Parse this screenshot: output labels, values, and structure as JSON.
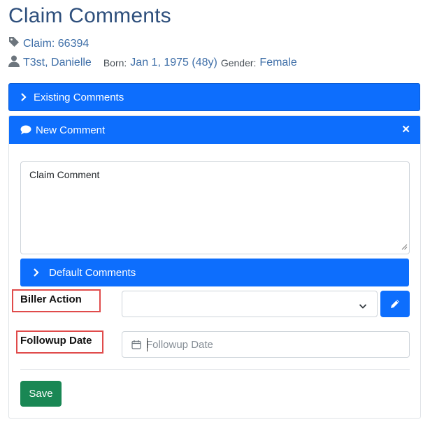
{
  "page": {
    "title": "Claim Comments"
  },
  "claim": {
    "label": "Claim: 66394"
  },
  "patient": {
    "name": "T3st, Danielle",
    "born_label": "Born:",
    "born_value": "Jan 1, 1975 (48y)",
    "gender_label": "Gender:",
    "gender_value": "Female"
  },
  "existing_comments": {
    "label": "Existing Comments",
    "expanded": false
  },
  "new_comment": {
    "label": "New Comment",
    "close_symbol": "✕",
    "comment_text": "Claim Comment",
    "default_comments_label": "Default Comments",
    "biller_action_label": "Biller Action",
    "biller_action_value": "",
    "followup_label": "Followup Date",
    "followup_placeholder": "Followup Date",
    "save_label": "Save"
  },
  "icons": {
    "tag": "tag-icon",
    "user": "user-icon",
    "chevron_right": "chevron-right-icon",
    "comment": "comment-icon",
    "close": "close-icon",
    "chevron_down": "chevron-down-icon",
    "pencil": "pencil-icon",
    "calendar": "calendar-icon"
  },
  "colors": {
    "primary": "#0d6efd",
    "title": "#2e4f7c",
    "link": "#3f6fa8",
    "success": "#198754",
    "highlight": "#e04b4b"
  }
}
